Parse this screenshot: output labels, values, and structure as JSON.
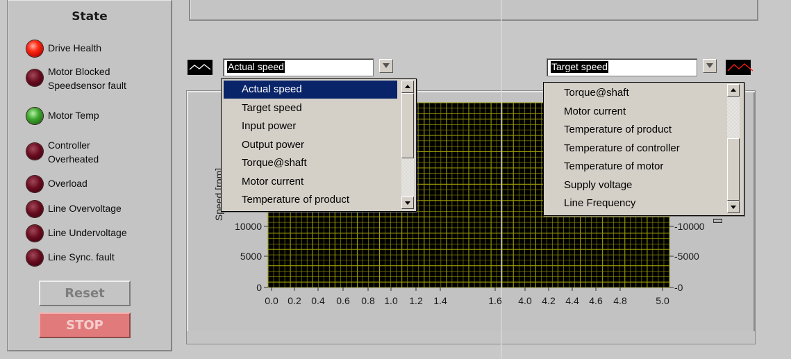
{
  "state_panel": {
    "title": "State",
    "indicators": [
      {
        "label": "Drive Health",
        "state": "red"
      },
      {
        "label": "Motor Blocked\nSpeedsensor fault",
        "state": "dark"
      },
      {
        "label": "Motor Temp",
        "state": "green"
      },
      {
        "label": "Controller\nOverheated",
        "state": "dark"
      },
      {
        "label": "Overload",
        "state": "dark"
      },
      {
        "label": "Line Overvoltage",
        "state": "dark"
      },
      {
        "label": "Line Undervoltage",
        "state": "dark"
      },
      {
        "label": "Line Sync. fault",
        "state": "dark"
      }
    ],
    "reset_label": "Reset",
    "stop_label": "STOP"
  },
  "left_selector": {
    "value": "Actual speed",
    "options": [
      "Actual speed",
      "Target speed",
      "Input power",
      "Output power",
      "Torque@shaft",
      "Motor current",
      "Temperature of product"
    ],
    "selected": "Actual speed"
  },
  "right_selector": {
    "value": "Target speed",
    "options": [
      "Torque@shaft",
      "Motor current",
      "Temperature of product",
      "Temperature of controller",
      "Temperature of motor",
      "Supply voltage",
      "Line Frequency"
    ]
  },
  "graph": {
    "y_axis_label_left": "Speed [rpm]",
    "y_axis_label_right": "[]",
    "y_ticks_left": [
      "0",
      "5000",
      "10000"
    ],
    "y_ticks_right": [
      "0",
      "5000",
      "10000"
    ],
    "x_ticks": [
      "0.0",
      "0.2",
      "0.4",
      "0.6",
      "0.8",
      "1.0",
      "1.2",
      "1.4",
      "1.6",
      "4.0",
      "4.2",
      "4.4",
      "4.6",
      "4.8",
      "5.0"
    ],
    "plot_bg": "#000000",
    "grid_color": "#a0a000",
    "left_trace_color": "#ffffff",
    "right_trace_color": "#ff0000"
  }
}
